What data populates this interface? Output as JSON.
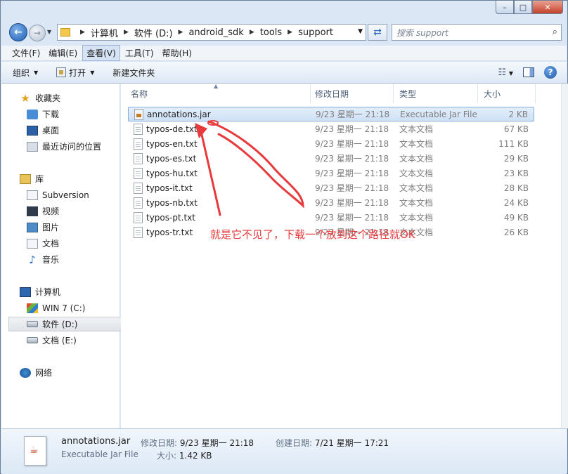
{
  "window": {
    "buttons": [
      "minimize",
      "maximize",
      "close"
    ]
  },
  "address": {
    "crumbs": [
      "计算机",
      "软件 (D:)",
      "android_sdk",
      "tools",
      "support"
    ],
    "search_placeholder": "搜索 support"
  },
  "menu": [
    "文件(F)",
    "编辑(E)",
    "查看(V)",
    "工具(T)",
    "帮助(H)"
  ],
  "commands": {
    "organize": "组织",
    "open": "打开",
    "new_folder": "新建文件夹"
  },
  "nav": {
    "favorites": "收藏夹",
    "downloads": "下载",
    "desktop": "桌面",
    "recent": "最近访问的位置",
    "libraries": "库",
    "subversion": "Subversion",
    "videos": "视频",
    "pictures": "图片",
    "documents": "文档",
    "music": "音乐",
    "computer": "计算机",
    "drive_c": "WIN 7 (C:)",
    "drive_d": "软件 (D:)",
    "drive_e": "文档 (E:)",
    "network": "网络"
  },
  "columns": {
    "name": "名称",
    "modified": "修改日期",
    "type": "类型",
    "size": "大小"
  },
  "files": [
    {
      "name": "annotations.jar",
      "date": "9/23 星期一 21:18",
      "type": "Executable Jar File",
      "size": "2 KB"
    },
    {
      "name": "typos-de.txt",
      "date": "9/23 星期一 21:18",
      "type": "文本文档",
      "size": "67 KB"
    },
    {
      "name": "typos-en.txt",
      "date": "9/23 星期一 21:18",
      "type": "文本文档",
      "size": "111 KB"
    },
    {
      "name": "typos-es.txt",
      "date": "9/23 星期一 21:18",
      "type": "文本文档",
      "size": "29 KB"
    },
    {
      "name": "typos-hu.txt",
      "date": "9/23 星期一 21:18",
      "type": "文本文档",
      "size": "23 KB"
    },
    {
      "name": "typos-it.txt",
      "date": "9/23 星期一 21:18",
      "type": "文本文档",
      "size": "28 KB"
    },
    {
      "name": "typos-nb.txt",
      "date": "9/23 星期一 21:18",
      "type": "文本文档",
      "size": "24 KB"
    },
    {
      "name": "typos-pt.txt",
      "date": "9/23 星期一 21:18",
      "type": "文本文档",
      "size": "49 KB"
    },
    {
      "name": "typos-tr.txt",
      "date": "9/23 星期一 21:18",
      "type": "文本文档",
      "size": "26 KB"
    }
  ],
  "annotation": {
    "text": "就是它不见了，下载一个放到这个路径就OK",
    "color": "#e8393c"
  },
  "details": {
    "name": "annotations.jar",
    "type": "Executable Jar File",
    "modified_label": "修改日期:",
    "modified_value": "9/23 星期一 21:18",
    "created_label": "创建日期:",
    "created_value": "7/21 星期一 17:21",
    "size_label": "大小:",
    "size_value": "1.42 KB"
  }
}
